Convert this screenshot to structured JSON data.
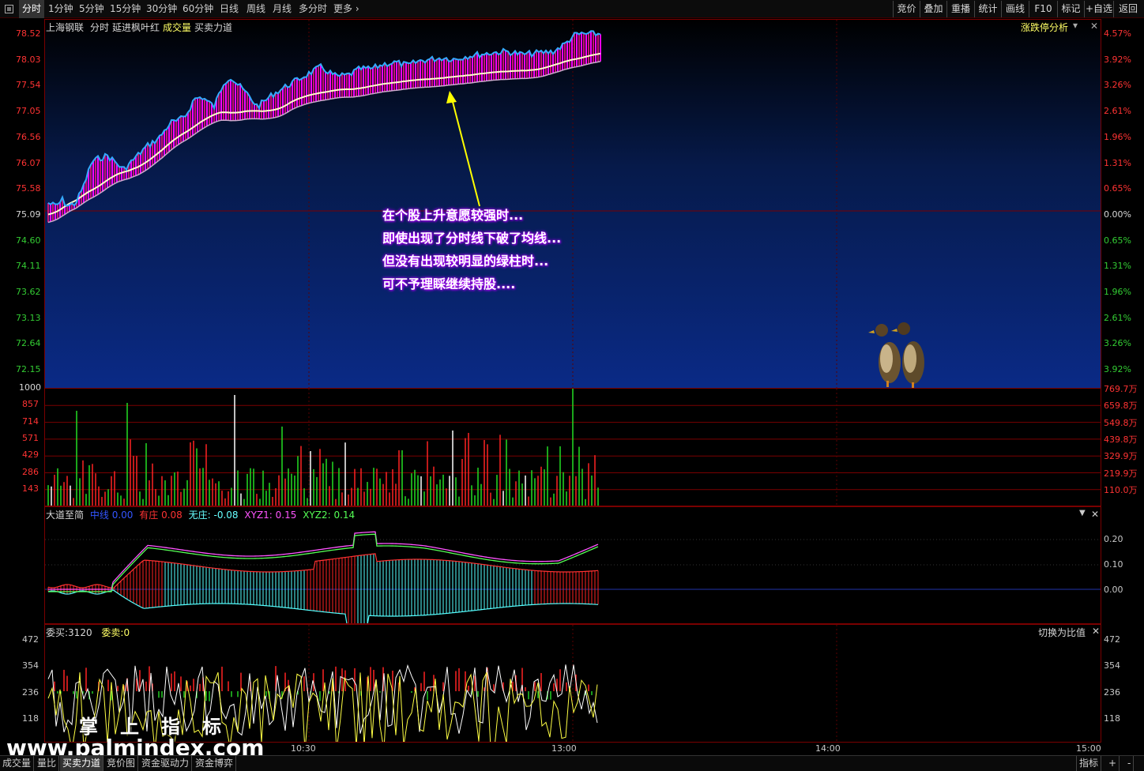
{
  "toolbar": {
    "periods": [
      "分时",
      "1分钟",
      "5分钟",
      "15分钟",
      "30分钟",
      "60分钟",
      "日线",
      "周线",
      "月线",
      "多分时",
      "更多"
    ],
    "right_buttons": [
      "竞价",
      "叠加",
      "重播",
      "统计",
      "画线",
      "F10",
      "标记",
      "+自选",
      "返回"
    ]
  },
  "price_header": {
    "stock_name": "上海钢联",
    "mode": "分时",
    "indicator": "延进枫叶红",
    "volume_label": "成交量",
    "force_label": "买卖力道",
    "limit_analysis": "涨跌停分析"
  },
  "price_axis_left": [
    "78.52",
    "78.03",
    "77.54",
    "77.05",
    "76.56",
    "76.07",
    "75.58",
    "75.09",
    "74.60",
    "74.11",
    "73.62",
    "73.13",
    "72.64",
    "72.15"
  ],
  "price_axis_right": [
    "4.57%",
    "3.92%",
    "3.26%",
    "2.61%",
    "1.96%",
    "1.31%",
    "0.65%",
    "0.00%",
    "0.65%",
    "1.31%",
    "1.96%",
    "2.61%",
    "3.26%",
    "3.92%"
  ],
  "vol_axis_left": [
    "1000",
    "857",
    "714",
    "571",
    "429",
    "286",
    "143"
  ],
  "vol_axis_right": [
    "769.7万",
    "659.8万",
    "549.8万",
    "439.8万",
    "329.9万",
    "219.9万",
    "110.0万"
  ],
  "indicator_header": {
    "name": "大道至简",
    "mid_label": "中线",
    "mid_value": "0.00",
    "dealer_label": "有庄",
    "dealer_value": "0.08",
    "nodealer_label": "无庄",
    "nodealer_value": "-0.08",
    "xyz1_label": "XYZ1",
    "xyz1_value": "0.15",
    "xyz2_label": "XYZ2",
    "xyz2_value": "0.14"
  },
  "ind_axis_right": [
    "0.20",
    "0.10",
    "0.00"
  ],
  "bs_header": {
    "buy_label": "委买:",
    "buy_value": "3120",
    "sell_label": "委卖:",
    "sell_value": "0",
    "switch_label": "切换为比值"
  },
  "bs_axis": [
    "472",
    "354",
    "236",
    "118"
  ],
  "time_axis": [
    "10:30",
    "13:00",
    "14:00",
    "15:00"
  ],
  "callout_lines": [
    "在个股上升意愿较强时...",
    "即使出现了分时线下破了均线...",
    "但没有出现较明显的绿柱时...",
    "可不予理睬继续持股...."
  ],
  "watermark": {
    "cn": "掌上指标",
    "url": "www.palmindex.com"
  },
  "bottom_tabs": [
    "成交量",
    "量比",
    "买卖力道",
    "竞价图",
    "资金驱动力",
    "资金博弈"
  ],
  "bottom_right": [
    "指标",
    "+",
    "-"
  ],
  "colors": {
    "up": "#ff3333",
    "down": "#33cc33",
    "price_line": "#33aaff",
    "avg_line": "#ffffcc",
    "fill_up": "#ff00ff",
    "arrow": "#ffff00"
  }
}
